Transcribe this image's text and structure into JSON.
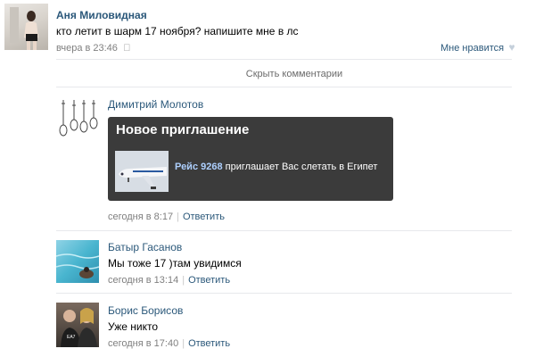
{
  "post": {
    "author": "Аня Миловидная",
    "text": "кто летит в шарм 17 ноября? напишите мне в лс",
    "time": "вчера в 23:46",
    "like_label": "Мне нравится",
    "hide_comments": "Скрыть комментарии"
  },
  "comments": [
    {
      "author": "Димитрий Молотов",
      "card": {
        "title": "Новое приглашение",
        "flight": "Рейс 9268",
        "invite_text": "приглашает Вас слетать в Египет"
      },
      "time": "сегодня в 8:17",
      "reply": "Ответить"
    },
    {
      "author": "Батыр Гасанов",
      "text": "Мы тоже 17 )там увидимся",
      "time": "сегодня в 13:14",
      "reply": "Ответить"
    },
    {
      "author": "Борис Борисов",
      "text": "Уже никто",
      "time": "сегодня в 17:40",
      "reply": "Ответить"
    }
  ],
  "colors": {
    "link": "#2b587a",
    "meta": "#7f7f7f",
    "card_bg": "#3b3b3b",
    "flight": "#aed0ff",
    "divider": "#e7e8ec"
  }
}
